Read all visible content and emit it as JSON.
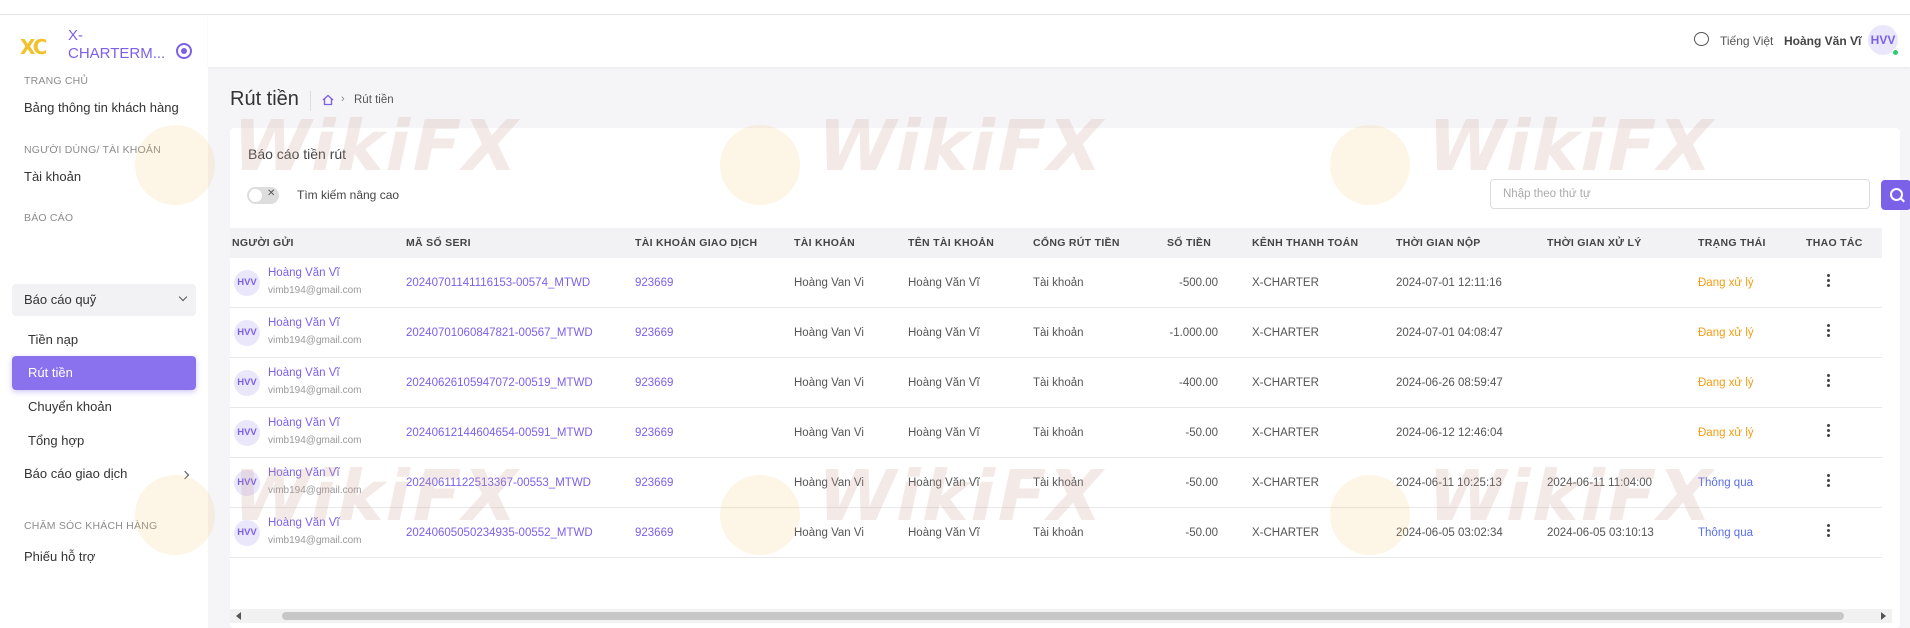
{
  "app": {
    "name": "X-CHARTERM...",
    "logo": "XC"
  },
  "sidebar": {
    "sections": [
      {
        "title": "TRANG CHỦ"
      },
      {
        "title": "NGƯỜI DÙNG/ TÀI KHOẢN"
      },
      {
        "title": "BÁO CÁO"
      },
      {
        "title": "CHĂM SÓC KHÁCH HÀNG"
      }
    ],
    "items": {
      "dashboard": "Bảng thông tin khách hàng",
      "account": "Tài khoản",
      "fund_report": "Báo cáo quỹ",
      "deposit": "Tiền nạp",
      "withdraw": "Rút tiền",
      "transfer": "Chuyển khoản",
      "summary": "Tổng hợp",
      "trade_report": "Báo cáo giao dịch",
      "support": "Phiếu hỗ trợ"
    }
  },
  "header": {
    "language": "Tiếng Việt",
    "user_name": "Hoàng Văn Vĩ",
    "user_initials": "HVV"
  },
  "page": {
    "title": "Rút tiền",
    "breadcrumb": "Rút tiền"
  },
  "card": {
    "title": "Báo cáo tiền rút",
    "toggle_x": "✕",
    "advanced_search": "Tìm kiếm nâng cao",
    "search_placeholder": "Nhập theo thứ tự"
  },
  "table": {
    "headers": [
      "NGƯỜI GỬI",
      "MÃ SỐ SERI",
      "TÀI KHOẢN GIAO DỊCH",
      "TÀI KHOẢN",
      "TÊN TÀI KHOẢN",
      "CỔNG RÚT TIỀN",
      "SỐ TIỀN",
      "KÊNH THANH TOÁN",
      "THỜI GIAN NỘP",
      "THỜI GIAN XỬ LÝ",
      "TRẠNG THÁI",
      "THAO TÁC"
    ],
    "rows": [
      {
        "initials": "HVV",
        "sender": "Hoàng Văn Vĩ",
        "email": "vimb194@gmail.com",
        "serial": "20240701141116153-00574_MTWD",
        "trade_account": "923669",
        "account": "Hoàng Van Vi",
        "account_name": "Hoàng Văn Vĩ",
        "gateway": "Tài khoản",
        "amount": "-500.00",
        "channel": "X-CHARTER",
        "submitted": "2024-07-01 12:11:16",
        "processed": "",
        "status": "Đang xử lý"
      },
      {
        "initials": "HVV",
        "sender": "Hoàng Văn Vĩ",
        "email": "vimb194@gmail.com",
        "serial": "20240701060847821-00567_MTWD",
        "trade_account": "923669",
        "account": "Hoàng Van Vi",
        "account_name": "Hoàng Văn Vĩ",
        "gateway": "Tài khoản",
        "amount": "-1.000.00",
        "channel": "X-CHARTER",
        "submitted": "2024-07-01 04:08:47",
        "processed": "",
        "status": "Đang xử lý"
      },
      {
        "initials": "HVV",
        "sender": "Hoàng Văn Vĩ",
        "email": "vimb194@gmail.com",
        "serial": "20240626105947072-00519_MTWD",
        "trade_account": "923669",
        "account": "Hoàng Van Vi",
        "account_name": "Hoàng Văn Vĩ",
        "gateway": "Tài khoản",
        "amount": "-400.00",
        "channel": "X-CHARTER",
        "submitted": "2024-06-26 08:59:47",
        "processed": "",
        "status": "Đang xử lý"
      },
      {
        "initials": "HVV",
        "sender": "Hoàng Văn Vĩ",
        "email": "vimb194@gmail.com",
        "serial": "20240612144604654-00591_MTWD",
        "trade_account": "923669",
        "account": "Hoàng Van Vi",
        "account_name": "Hoàng Văn Vĩ",
        "gateway": "Tài khoản",
        "amount": "-50.00",
        "channel": "X-CHARTER",
        "submitted": "2024-06-12 12:46:04",
        "processed": "",
        "status": "Đang xử lý"
      },
      {
        "initials": "HVV",
        "sender": "Hoàng Văn Vĩ",
        "email": "vimb194@gmail.com",
        "serial": "20240611122513367-00553_MTWD",
        "trade_account": "923669",
        "account": "Hoàng Van Vi",
        "account_name": "Hoàng Văn Vĩ",
        "gateway": "Tài khoản",
        "amount": "-50.00",
        "channel": "X-CHARTER",
        "submitted": "2024-06-11 10:25:13",
        "processed": "2024-06-11 11:04:00",
        "status": "Thông qua"
      },
      {
        "initials": "HVV",
        "sender": "Hoàng Văn Vĩ",
        "email": "vimb194@gmail.com",
        "serial": "20240605050234935-00552_MTWD",
        "trade_account": "923669",
        "account": "Hoàng Van Vi",
        "account_name": "Hoàng Văn Vĩ",
        "gateway": "Tài khoản",
        "amount": "-50.00",
        "channel": "X-CHARTER",
        "submitted": "2024-06-05 03:02:34",
        "processed": "2024-06-05 03:10:13",
        "status": "Thông qua"
      }
    ]
  },
  "watermark": "WikiFX",
  "colors": {
    "accent": "#7b61e8",
    "pending": "#f39c12",
    "approved": "#5b6ee8",
    "logo": "#f2c12e"
  }
}
